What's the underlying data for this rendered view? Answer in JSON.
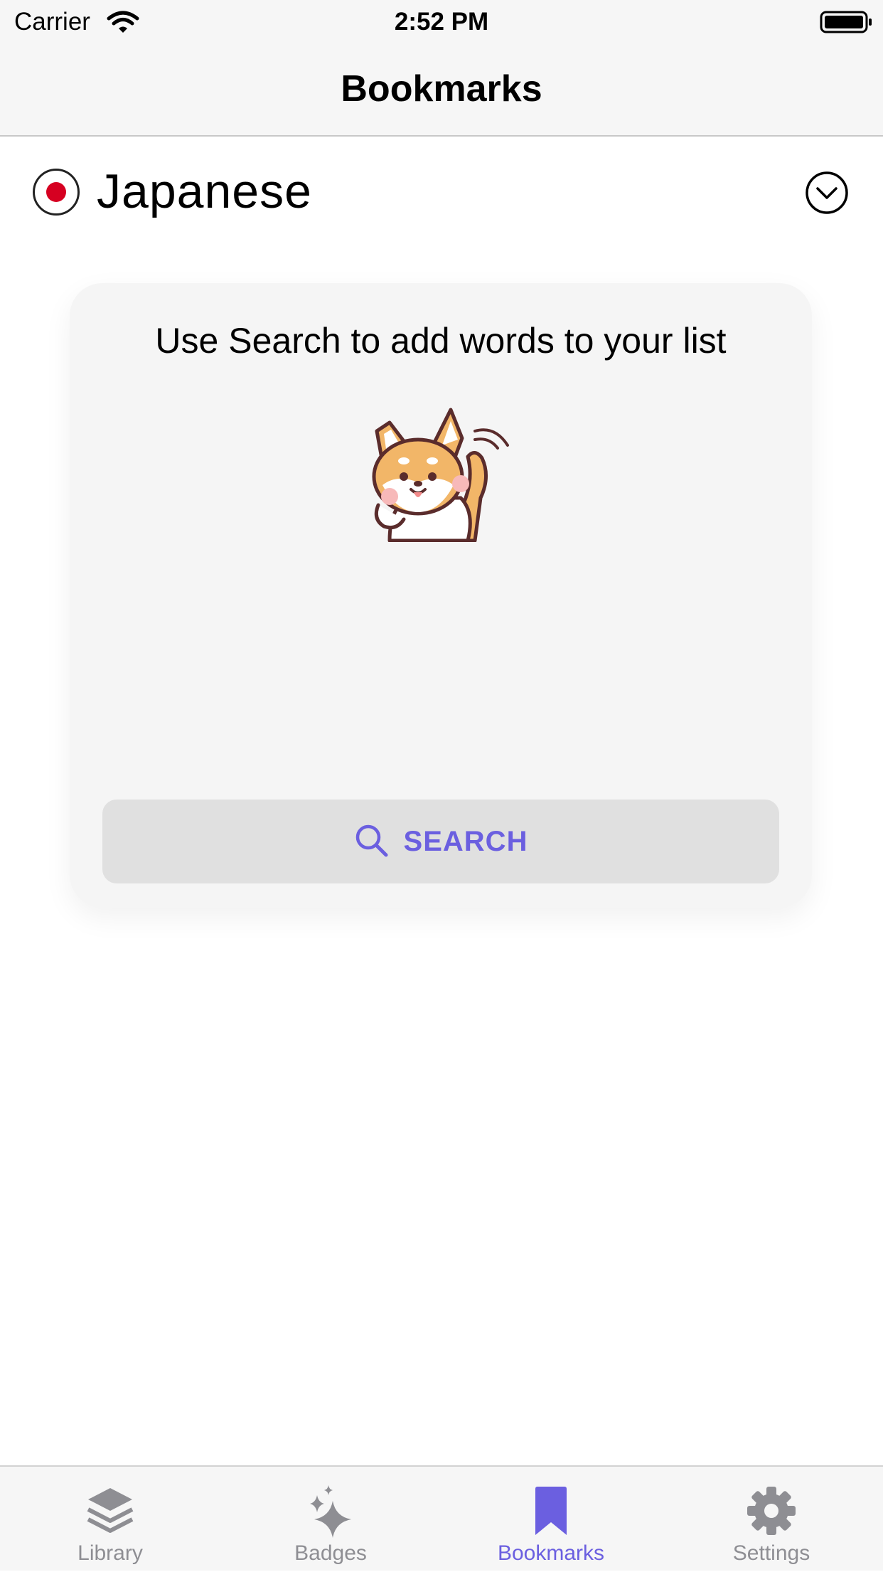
{
  "status_bar": {
    "carrier": "Carrier",
    "time": "2:52 PM"
  },
  "nav": {
    "title": "Bookmarks"
  },
  "language": {
    "name": "Japanese",
    "flag_icon": "japan-flag-icon"
  },
  "card": {
    "message": "Use Search to add words to your list",
    "search_label": "SEARCH"
  },
  "tabs": [
    {
      "label": "Library",
      "icon": "layers-icon",
      "active": false
    },
    {
      "label": "Badges",
      "icon": "sparkles-icon",
      "active": false
    },
    {
      "label": "Bookmarks",
      "icon": "bookmark-icon",
      "active": true
    },
    {
      "label": "Settings",
      "icon": "gear-icon",
      "active": false
    }
  ],
  "colors": {
    "accent": "#6b5fe0",
    "flag_red": "#d60021",
    "inactive_tab": "#8e8e93"
  }
}
